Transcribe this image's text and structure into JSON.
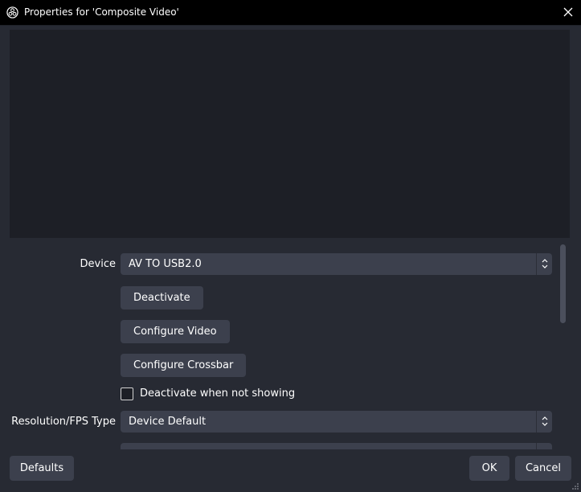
{
  "window": {
    "title": "Properties for 'Composite Video'",
    "app_icon": "obs-logo-icon",
    "close_icon": "close-icon"
  },
  "form": {
    "device": {
      "label": "Device",
      "value": "AV TO USB2.0"
    },
    "deactivate_button": "Deactivate",
    "configure_video_button": "Configure Video",
    "configure_crossbar_button": "Configure Crossbar",
    "deactivate_when_not_showing": {
      "label": "Deactivate when not showing",
      "checked": false
    },
    "resolution_fps_type": {
      "label": "Resolution/FPS Type",
      "value": "Device Default"
    }
  },
  "footer": {
    "defaults_button": "Defaults",
    "ok_button": "OK",
    "cancel_button": "Cancel"
  },
  "colors": {
    "background": "#272a33",
    "titlebar": "#000000",
    "preview": "#1d1f26",
    "control": "#3c404d"
  }
}
